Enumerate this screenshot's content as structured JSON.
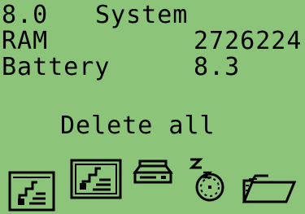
{
  "header": {
    "version": "8.0",
    "title": "System"
  },
  "info": {
    "ram_label": "RAM",
    "ram_value": "2726224",
    "battery_label": "Battery",
    "battery_value": "8.3"
  },
  "menu": {
    "selected_action": "Delete all"
  },
  "toolbar": {
    "icons": [
      "document-icon",
      "document-selected-icon",
      "drive-icon",
      "timer-icon",
      "folder-icon"
    ]
  },
  "colors": {
    "background": "#8cc47a",
    "foreground": "#000000"
  }
}
